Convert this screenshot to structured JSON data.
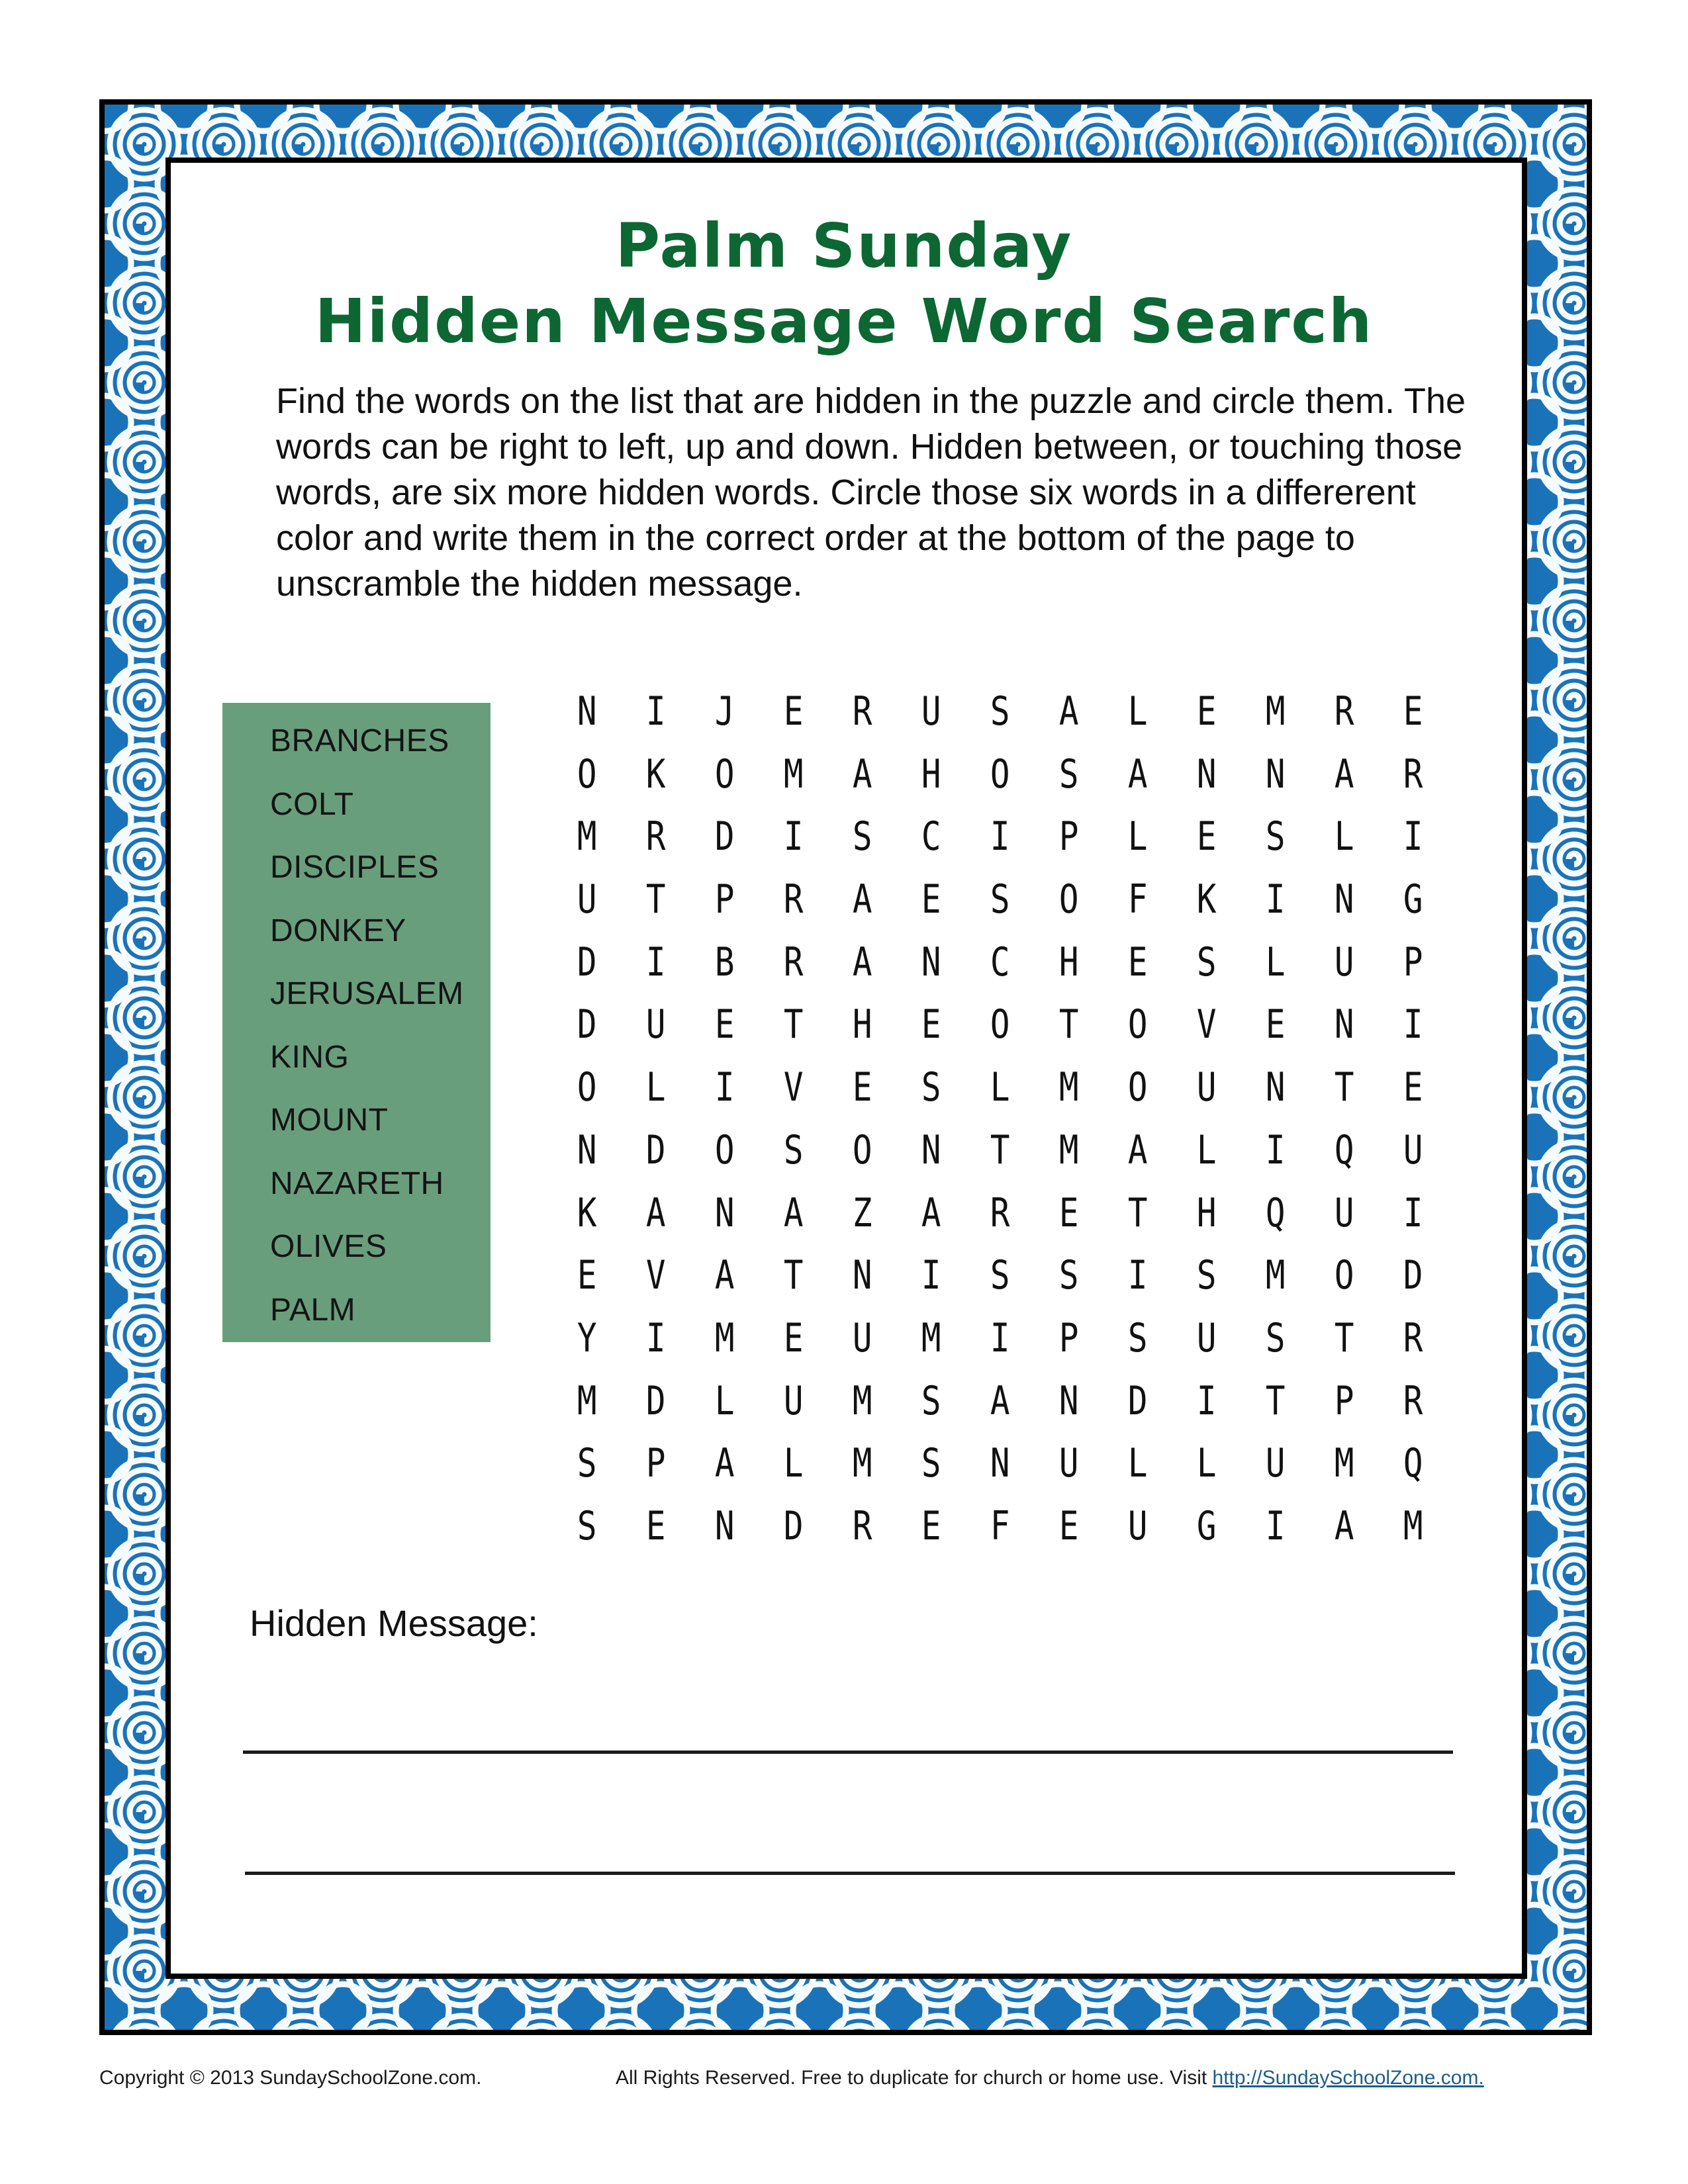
{
  "document": {
    "title_line_1": "Palm Sunday",
    "title_line_2": "Hidden Message Word Search",
    "instructions": "Find the words on the list that are hidden in the puzzle and circle them. The words can be right to left, up and down. Hidden between, or touching those words, are six more hidden words. Circle those six words in a differerent color and write them in the correct order at the bottom of the page to unscramble the hidden message.",
    "theme_colors": {
      "title_green": "#0c6733",
      "word_box_green": "#699e7c",
      "border_blue": "#1a73b8",
      "link_blue": "#1c5e8c"
    }
  },
  "word_list": [
    "BRANCHES",
    "COLT",
    "DISCIPLES",
    "DONKEY",
    "JERUSALEM",
    "KING",
    "MOUNT",
    "NAZARETH",
    "OLIVES",
    "PALM"
  ],
  "puzzle": {
    "rows": [
      [
        "N",
        "I",
        "J",
        "E",
        "R",
        "U",
        "S",
        "A",
        "L",
        "E",
        "M",
        "R",
        "E"
      ],
      [
        "O",
        "K",
        "O",
        "M",
        "A",
        "H",
        "O",
        "S",
        "A",
        "N",
        "N",
        "A",
        "R"
      ],
      [
        "M",
        "R",
        "D",
        "I",
        "S",
        "C",
        "I",
        "P",
        "L",
        "E",
        "S",
        "L",
        "I"
      ],
      [
        "U",
        "T",
        "P",
        "R",
        "A",
        "E",
        "S",
        "O",
        "F",
        "K",
        "I",
        "N",
        "G"
      ],
      [
        "D",
        "I",
        "B",
        "R",
        "A",
        "N",
        "C",
        "H",
        "E",
        "S",
        "L",
        "U",
        "P"
      ],
      [
        "D",
        "U",
        "E",
        "T",
        "H",
        "E",
        "O",
        "T",
        "O",
        "V",
        "E",
        "N",
        "I"
      ],
      [
        "O",
        "L",
        "I",
        "V",
        "E",
        "S",
        "L",
        "M",
        "O",
        "U",
        "N",
        "T",
        "E"
      ],
      [
        "N",
        "D",
        "O",
        "S",
        "O",
        "N",
        "T",
        "M",
        "A",
        "L",
        "I",
        "Q",
        "U"
      ],
      [
        "K",
        "A",
        "N",
        "A",
        "Z",
        "A",
        "R",
        "E",
        "T",
        "H",
        "Q",
        "U",
        "I"
      ],
      [
        "E",
        "V",
        "A",
        "T",
        "N",
        "I",
        "S",
        "S",
        "I",
        "S",
        "M",
        "O",
        "D"
      ],
      [
        "Y",
        "I",
        "M",
        "E",
        "U",
        "M",
        "I",
        "P",
        "S",
        "U",
        "S",
        "T",
        "R"
      ],
      [
        "M",
        "D",
        "L",
        "U",
        "M",
        "S",
        "A",
        "N",
        "D",
        "I",
        "T",
        "P",
        "R"
      ],
      [
        "S",
        "P",
        "A",
        "L",
        "M",
        "S",
        "N",
        "U",
        "L",
        "L",
        "U",
        "M",
        "Q"
      ],
      [
        "S",
        "E",
        "N",
        "D",
        "R",
        "E",
        "F",
        "E",
        "U",
        "G",
        "I",
        "A",
        "M"
      ]
    ]
  },
  "hidden_message": {
    "label": "Hidden Message:",
    "answer_lines": [
      "",
      ""
    ]
  },
  "footer": {
    "copyright": "Copyright © 2013 SundaySchoolZone.com.",
    "rights": "All Rights Reserved. Free to duplicate for church or home use. Visit ",
    "link_text": "http://SundaySchoolZone.com."
  }
}
